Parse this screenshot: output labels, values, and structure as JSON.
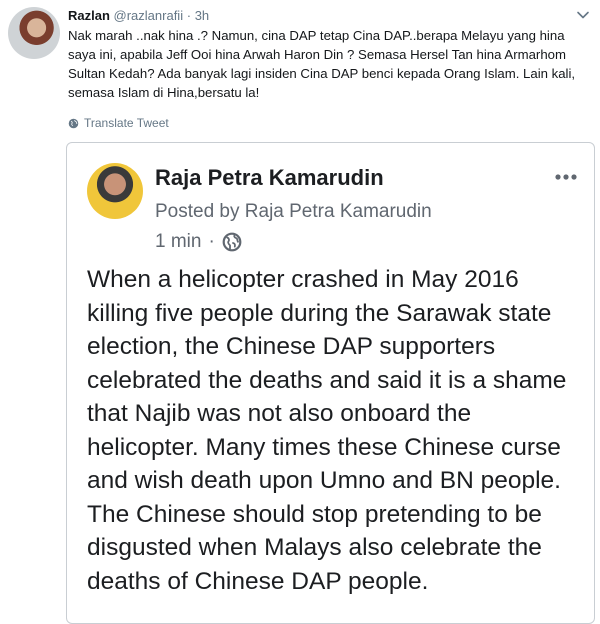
{
  "tweet": {
    "author_name": "Razlan",
    "author_handle": "@razlanrafii",
    "separator": "·",
    "timestamp": "3h",
    "text": "Nak marah ..nak hina .? Namun, cina DAP tetap Cina DAP..berapa Melayu yang hina saya ini, apabila Jeff Ooi hina Arwah Haron Din ? Semasa Hersel Tan hina Armarhom Sultan Kedah? Ada banyak lagi insiden Cina DAP benci kepada Orang Islam. Lain kali, semasa Islam di Hina,bersatu la!",
    "translate_label": "Translate Tweet",
    "icons": {
      "menu": "chevron-down-icon",
      "translate": "globe-icon",
      "avatar": "avatar"
    }
  },
  "embedded_post": {
    "author_name": "Raja Petra Kamarudin",
    "posted_by": "Posted by Raja Petra Kamarudin",
    "time": "1 min",
    "separator": "·",
    "body": "When a helicopter crashed in May 2016 killing five people during the Sarawak state election, the Chinese DAP supporters celebrated the deaths and said it is a shame that Najib was not also onboard the helicopter. Many times these Chinese curse and wish death upon Umno and BN people. The Chinese should stop pretending to be disgusted when Malays also celebrate the deaths of Chinese DAP people.",
    "icons": {
      "privacy": "globe-icon",
      "menu": "more-horizontal-icon"
    }
  },
  "colors": {
    "text": "#14171a",
    "muted": "#657786",
    "fb_text": "#1c1e21",
    "fb_muted": "#606770",
    "border": "#c9ced3"
  }
}
